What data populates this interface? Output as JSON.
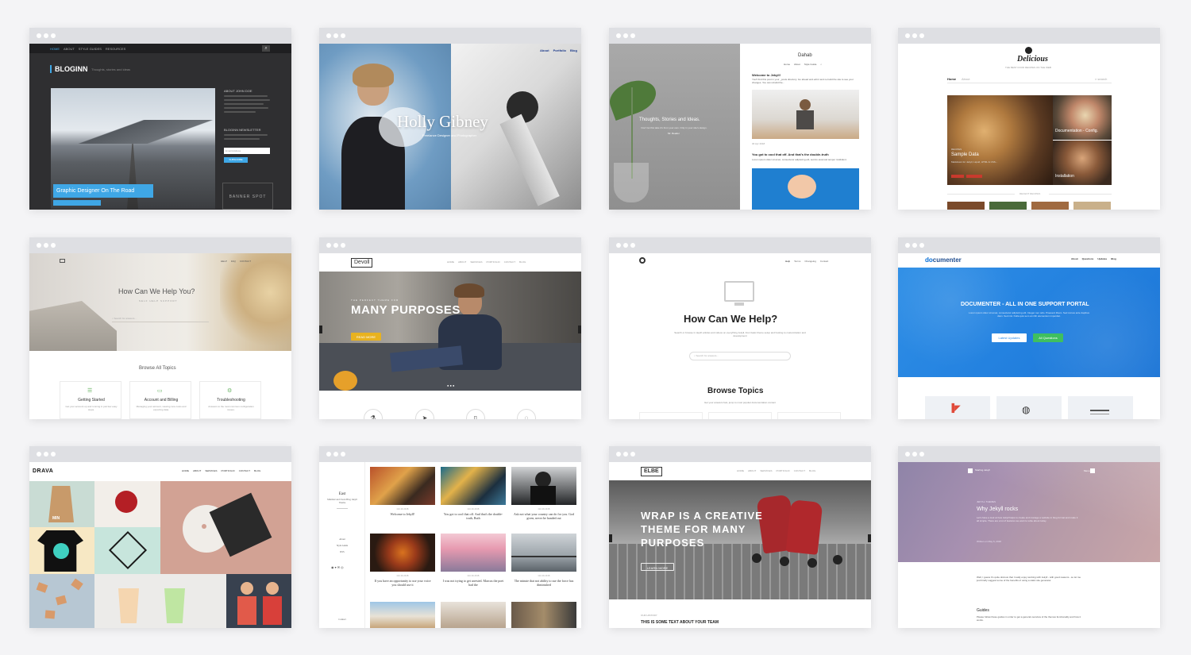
{
  "themes": [
    {
      "name": "Bloginn",
      "logo": "BLOGINN",
      "tagline": "Thoughts, stories and ideas",
      "nav": [
        "HOME",
        "ABOUT",
        "STYLE GUIDES",
        "RESOURCES"
      ],
      "feature_title": "Graphic Designer On The Road",
      "feature_meta": "BY JOHN DOE ON MARCH 18, 2018",
      "about_head": "ABOUT JOHN DOE",
      "newsletter_head": "BLOGINN NEWSLETTER",
      "newsletter_placeholder": "Email Address",
      "subscribe": "SUBSCRIBE",
      "banner": "BANNER SPOT"
    },
    {
      "name": "Holly Gibney",
      "title": "Holly Gibney",
      "subtitle": "Freelance Designer and Photographer",
      "nav": [
        "About",
        "Portfolio",
        "Blog"
      ]
    },
    {
      "name": "Dahab",
      "brand": "Dahab",
      "nav": [
        "Home",
        "About",
        "Style Guide"
      ],
      "left_title": "Thoughts, Stories and Ideas.",
      "left_text": "Don't let this take it's from your own. Only in your site's design.",
      "left_link": "Mr. Reader",
      "post1_title": "Welcome to Jekyll!",
      "post1_text": "You'll find this post in your _posts directory. Go ahead and edit it and re-build the site to see your changes. You can rebuild the...",
      "post1_meta": "30 Apr 2018",
      "post2_title": "You got to cool that off. And that's the double-truth",
      "post2_text": "Lorem ipsum dolor sit amet, consectetur adipiscing elit, sed do eiusmod tempor incididunt."
    },
    {
      "name": "Delicious",
      "brand": "Delicious",
      "tagline": "THE BEST FOOD RECIPES ON THE WEB",
      "tabs": [
        "Home",
        "About"
      ],
      "search": "search",
      "post_main": "Sample Data",
      "post_main_text": "Markdown for Jekyll, Liquid, HTML & CSS...",
      "post_main_tag": "RECIPES",
      "post_a": "Documentation - Config.",
      "post_b": "Installation",
      "recent": "RECENT RECIPES"
    },
    {
      "name": "Help Center",
      "nav": [
        "HELP",
        "FAQ",
        "CONTACT"
      ],
      "hero_title": "How Can We Help You?",
      "hero_sub": "SELF HELP SUPPORT",
      "search": "Search for answers...",
      "browse": "Browse All Topics",
      "topics": [
        {
          "title": "Getting Started",
          "desc": "Get your account up and running in just few easy steps."
        },
        {
          "title": "Account and Billing",
          "desc": "Managing your account, viewing new costs and exporting data."
        },
        {
          "title": "Troubleshooting",
          "desc": "Answers to the most common configuration issues."
        }
      ]
    },
    {
      "name": "Devoll",
      "brand": "Devoll",
      "nav": [
        "HOME",
        "ABOUT",
        "SERVICES",
        "PORTFOLIO",
        "CONTACT",
        "BLOG"
      ],
      "eyebrow": "THE PERFECT THEME FOR",
      "headline": "MANY PURPOSES",
      "cta": "READ MORE"
    },
    {
      "name": "Help Docs",
      "nav": [
        "Help",
        "Terms",
        "Changelog",
        "Contact"
      ],
      "title": "How Can We Help?",
      "desc": "Search or browse in depth articles and videos on everything Jekyll, from basic theme setup and hosting to customization and development",
      "search": "Search for answers...",
      "browse": "Browse Topics",
      "browse_sub": "Get your answers fast, jump to most popular documentation content"
    },
    {
      "name": "Documenter",
      "brand": "documenter",
      "nav": [
        "About",
        "Questions",
        "Updates",
        "Blog"
      ],
      "hero": "DOCUMENTER - ALL IN ONE SUPPORT PORTAL",
      "hero_text": "Lorem ipsum dolor sit amet, consectetur adipiscing elit. Integer nec odio. Praesent libero. Sed cursus ante dapibus diam. Sed nisi. Nulla quis sem at nibh elementum imperdiet.",
      "btn1": "Latest Updates",
      "btn2": "All Questions"
    },
    {
      "name": "Drava",
      "brand": "DRAVA",
      "nav": [
        "HOME",
        "ABOUT",
        "SERVICES",
        "PORTFOLIO",
        "CONTACT",
        "BLOG"
      ],
      "tile": "MIN"
    },
    {
      "name": "East",
      "brand": "East",
      "tagline": "Minimal and Clean Blog Jekyll Theme",
      "links": [
        "About",
        "Style Guide",
        "RSS"
      ],
      "posts": [
        {
          "date": "Oct 26 2018",
          "title": "Welcome to Jekyll!"
        },
        {
          "date": "Oct 26 2018",
          "title": "You got to cool that off. And that's the double-truth, Ruth"
        },
        {
          "date": "Oct 26 2018",
          "title": "Ask not what your country can do for you. God given, never be handed out"
        },
        {
          "date": "Oct 26 2018",
          "title": "If you have an opportunity to use your voice you should use it"
        },
        {
          "date": "Oct 26 2018",
          "title": "I was not trying to get arrested. Marcus the poet had the"
        },
        {
          "date": "Oct 26 2018",
          "title": "The minute that not ability to use the force has diminished"
        }
      ],
      "footer": "Contact"
    },
    {
      "name": "Elbe",
      "brand": "ELBE",
      "nav": [
        "HOME",
        "ABOUT",
        "SERVICES",
        "PORTFOLIO",
        "CONTACT",
        "BLOG"
      ],
      "headline": [
        "WRAP IS A CREATIVE",
        "THEME FOR MANY",
        "PURPOSES"
      ],
      "cta": "LEARN MORE",
      "team_label": "OUR HISTORY",
      "team_title": "THIS IS SOME TEXT ABOUT YOUR TEAM"
    },
    {
      "name": "Lens",
      "brand": "Starting Jekyll",
      "nav": [
        "Menu"
      ],
      "eyebrow": "JEKYLL THEMES",
      "title": "Why Jekyll rocks",
      "text": "Let's have a look at how Jekyll helps to create and manage a website in blog format and make it all simple. There are a lot of features we want to write about today.",
      "meta": "Written on May 6, 2018",
      "intro": "Well, I guess it's quite obvious that I really enjoy working with Jekyll - with good reasons - so let me just briefly suggest some of the benefits of using a static site generator.",
      "guides": "Guides",
      "guides_text": "Please follow these guides in order to get a general overview of the themes functionality and how it works."
    }
  ]
}
